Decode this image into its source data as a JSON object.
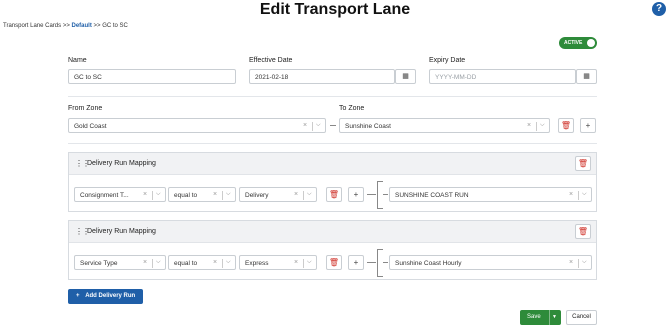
{
  "page": {
    "title": "Edit Transport Lane",
    "help_icon": "?"
  },
  "breadcrumb": {
    "root": "Transport Lane Cards",
    "sep1": ">>",
    "mid": "Default",
    "sep2": ">>",
    "current": "GC to SC"
  },
  "status_toggle": {
    "label": "ACTIVE",
    "on": true,
    "color": "#2e8b3a"
  },
  "form": {
    "name_label": "Name",
    "name_value": "GC to SC",
    "effective_label": "Effective Date",
    "effective_value": "2021-02-18",
    "expiry_label": "Expiry Date",
    "expiry_placeholder": "YYYY-MM-DD",
    "from_zone_label": "From Zone",
    "from_zone_value": "Gold Coast",
    "to_zone_label": "To Zone",
    "to_zone_value": "Sunshine Coast"
  },
  "mappings": [
    {
      "title": "Delivery Run Mapping",
      "field": "Consignment T...",
      "operator": "equal to",
      "value": "Delivery",
      "run": "SUNSHINE COAST RUN"
    },
    {
      "title": "Delivery Run Mapping",
      "field": "Service Type",
      "operator": "equal to",
      "value": "Express",
      "run": "Sunshine Coast Hourly"
    }
  ],
  "actions": {
    "add_run": "Add Delivery Run",
    "save": "Save",
    "cancel": "Cancel"
  },
  "colors": {
    "primary": "#1f5fa8",
    "success": "#2e8b3a",
    "danger": "#d0342c"
  }
}
